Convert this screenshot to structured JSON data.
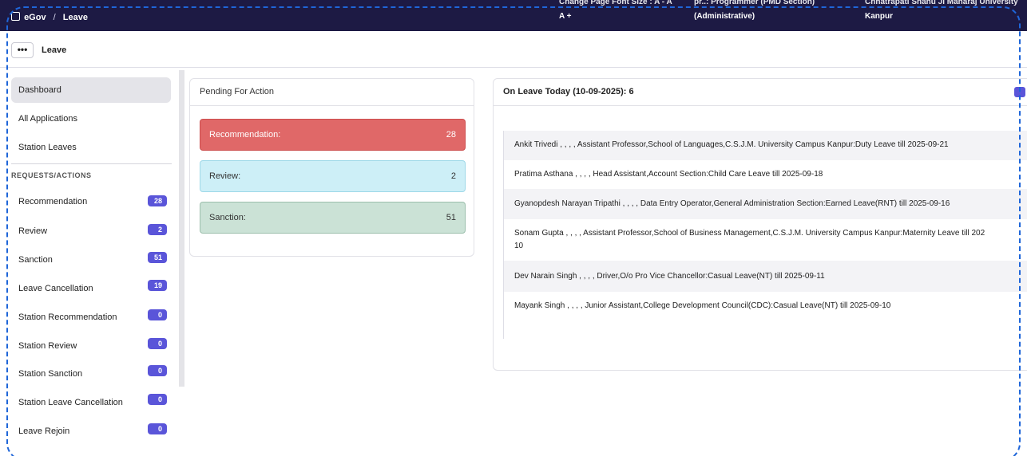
{
  "topbar": {
    "app": "eGov",
    "separator": "/",
    "module": "Leave",
    "font_size_line1": "Change Page Font Size :  A -  A",
    "font_size_line2": "A +",
    "role_line1": "pr..: Programmer (PMD Section)",
    "role_line2": "(Administrative)",
    "org_line1": "Chhatrapati Shahu Ji Maharaj University",
    "org_line2": "Kanpur"
  },
  "toolbar": {
    "menu_label": "•••",
    "title": "Leave"
  },
  "sidebar": {
    "top_items": [
      {
        "label": "Dashboard",
        "active": true
      },
      {
        "label": "All Applications"
      },
      {
        "label": "Station Leaves"
      }
    ],
    "section_title": "REQUESTS/ACTIONS",
    "items": [
      {
        "label": "Recommendation",
        "count": "28"
      },
      {
        "label": "Review",
        "count": "2"
      },
      {
        "label": "Sanction",
        "count": "51"
      },
      {
        "label": "Leave Cancellation",
        "count": "19"
      },
      {
        "label": "Station Recommendation",
        "count": "0"
      },
      {
        "label": "Station Review",
        "count": "0"
      },
      {
        "label": "Station Sanction",
        "count": "0"
      },
      {
        "label": "Station Leave Cancellation",
        "count": "0"
      },
      {
        "label": "Leave Rejoin",
        "count": "0"
      }
    ]
  },
  "pending": {
    "title": "Pending For Action",
    "items": [
      {
        "label": "Recommendation:",
        "count": "28"
      },
      {
        "label": "Review:",
        "count": "2"
      },
      {
        "label": "Sanction:",
        "count": "51"
      }
    ]
  },
  "on_leave": {
    "title": "On Leave Today (10-09-2025): 6",
    "rows": [
      {
        "text": "Ankit Trivedi , , , , Assistant Professor,School of Languages,C.S.J.M. University Campus Kanpur:Duty Leave till 2025-09-21"
      },
      {
        "text": "Pratima Asthana , , , , Head Assistant,Account Section:Child Care Leave till 2025-09-18"
      },
      {
        "text": "Gyanopdesh Narayan Tripathi , , , , Data Entry Operator,General Administration Section:Earned Leave(RNT) till 2025-09-16"
      },
      {
        "text": "Sonam Gupta , , , , Assistant Professor,School of Business Management,C.S.J.M. University Campus Kanpur:Maternity Leave till 202",
        "text2": "10"
      },
      {
        "text": "Dev Narain Singh , , , , Driver,O/o Pro Vice Chancellor:Casual Leave(NT) till 2025-09-11"
      },
      {
        "text": "Mayank Singh , , , , Junior Assistant,College Development Council(CDC):Casual Leave(NT) till 2025-09-10"
      }
    ]
  },
  "colors": {
    "topbar": "#1d1a44",
    "badge": "#5a55d9",
    "recommendation": "#e06868",
    "review": "#cdeff7",
    "sanction": "#cbe2d6",
    "frame_border": "#1f66d9"
  }
}
